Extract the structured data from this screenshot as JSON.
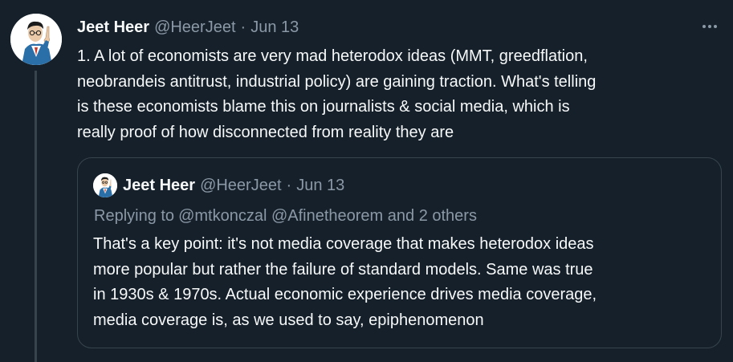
{
  "tweet": {
    "author_name": "Jeet Heer",
    "handle": "@HeerJeet",
    "separator": "·",
    "date": "Jun 13",
    "more_icon": "ellipsis-icon",
    "body_lines": [
      "1. A lot of economists are very mad heterodox ideas (MMT, greedflation,",
      "neobrandeis antitrust, industrial policy) are gaining traction. What's telling",
      "is these economists blame this on journalists & social media, which is",
      "really proof of how disconnected from reality they are"
    ]
  },
  "quoted_tweet": {
    "author_name": "Jeet Heer",
    "handle": "@HeerJeet",
    "separator": "·",
    "date": "Jun 13",
    "replying_label": "Replying to",
    "replying_targets": "@mtkonczal @Afinetheorem and 2 others",
    "body_lines": [
      "That's a key point: it's not media coverage that makes heterodox ideas",
      "more popular but rather the failure of standard models. Same was true",
      "in 1930s & 1970s. Actual economic experience drives media coverage,",
      "media coverage is, as we used to say, epiphenomenon"
    ]
  },
  "colors": {
    "background": "#15202b",
    "text": "#f7f9f9",
    "secondary": "#8b98a5",
    "border": "#38444d"
  }
}
